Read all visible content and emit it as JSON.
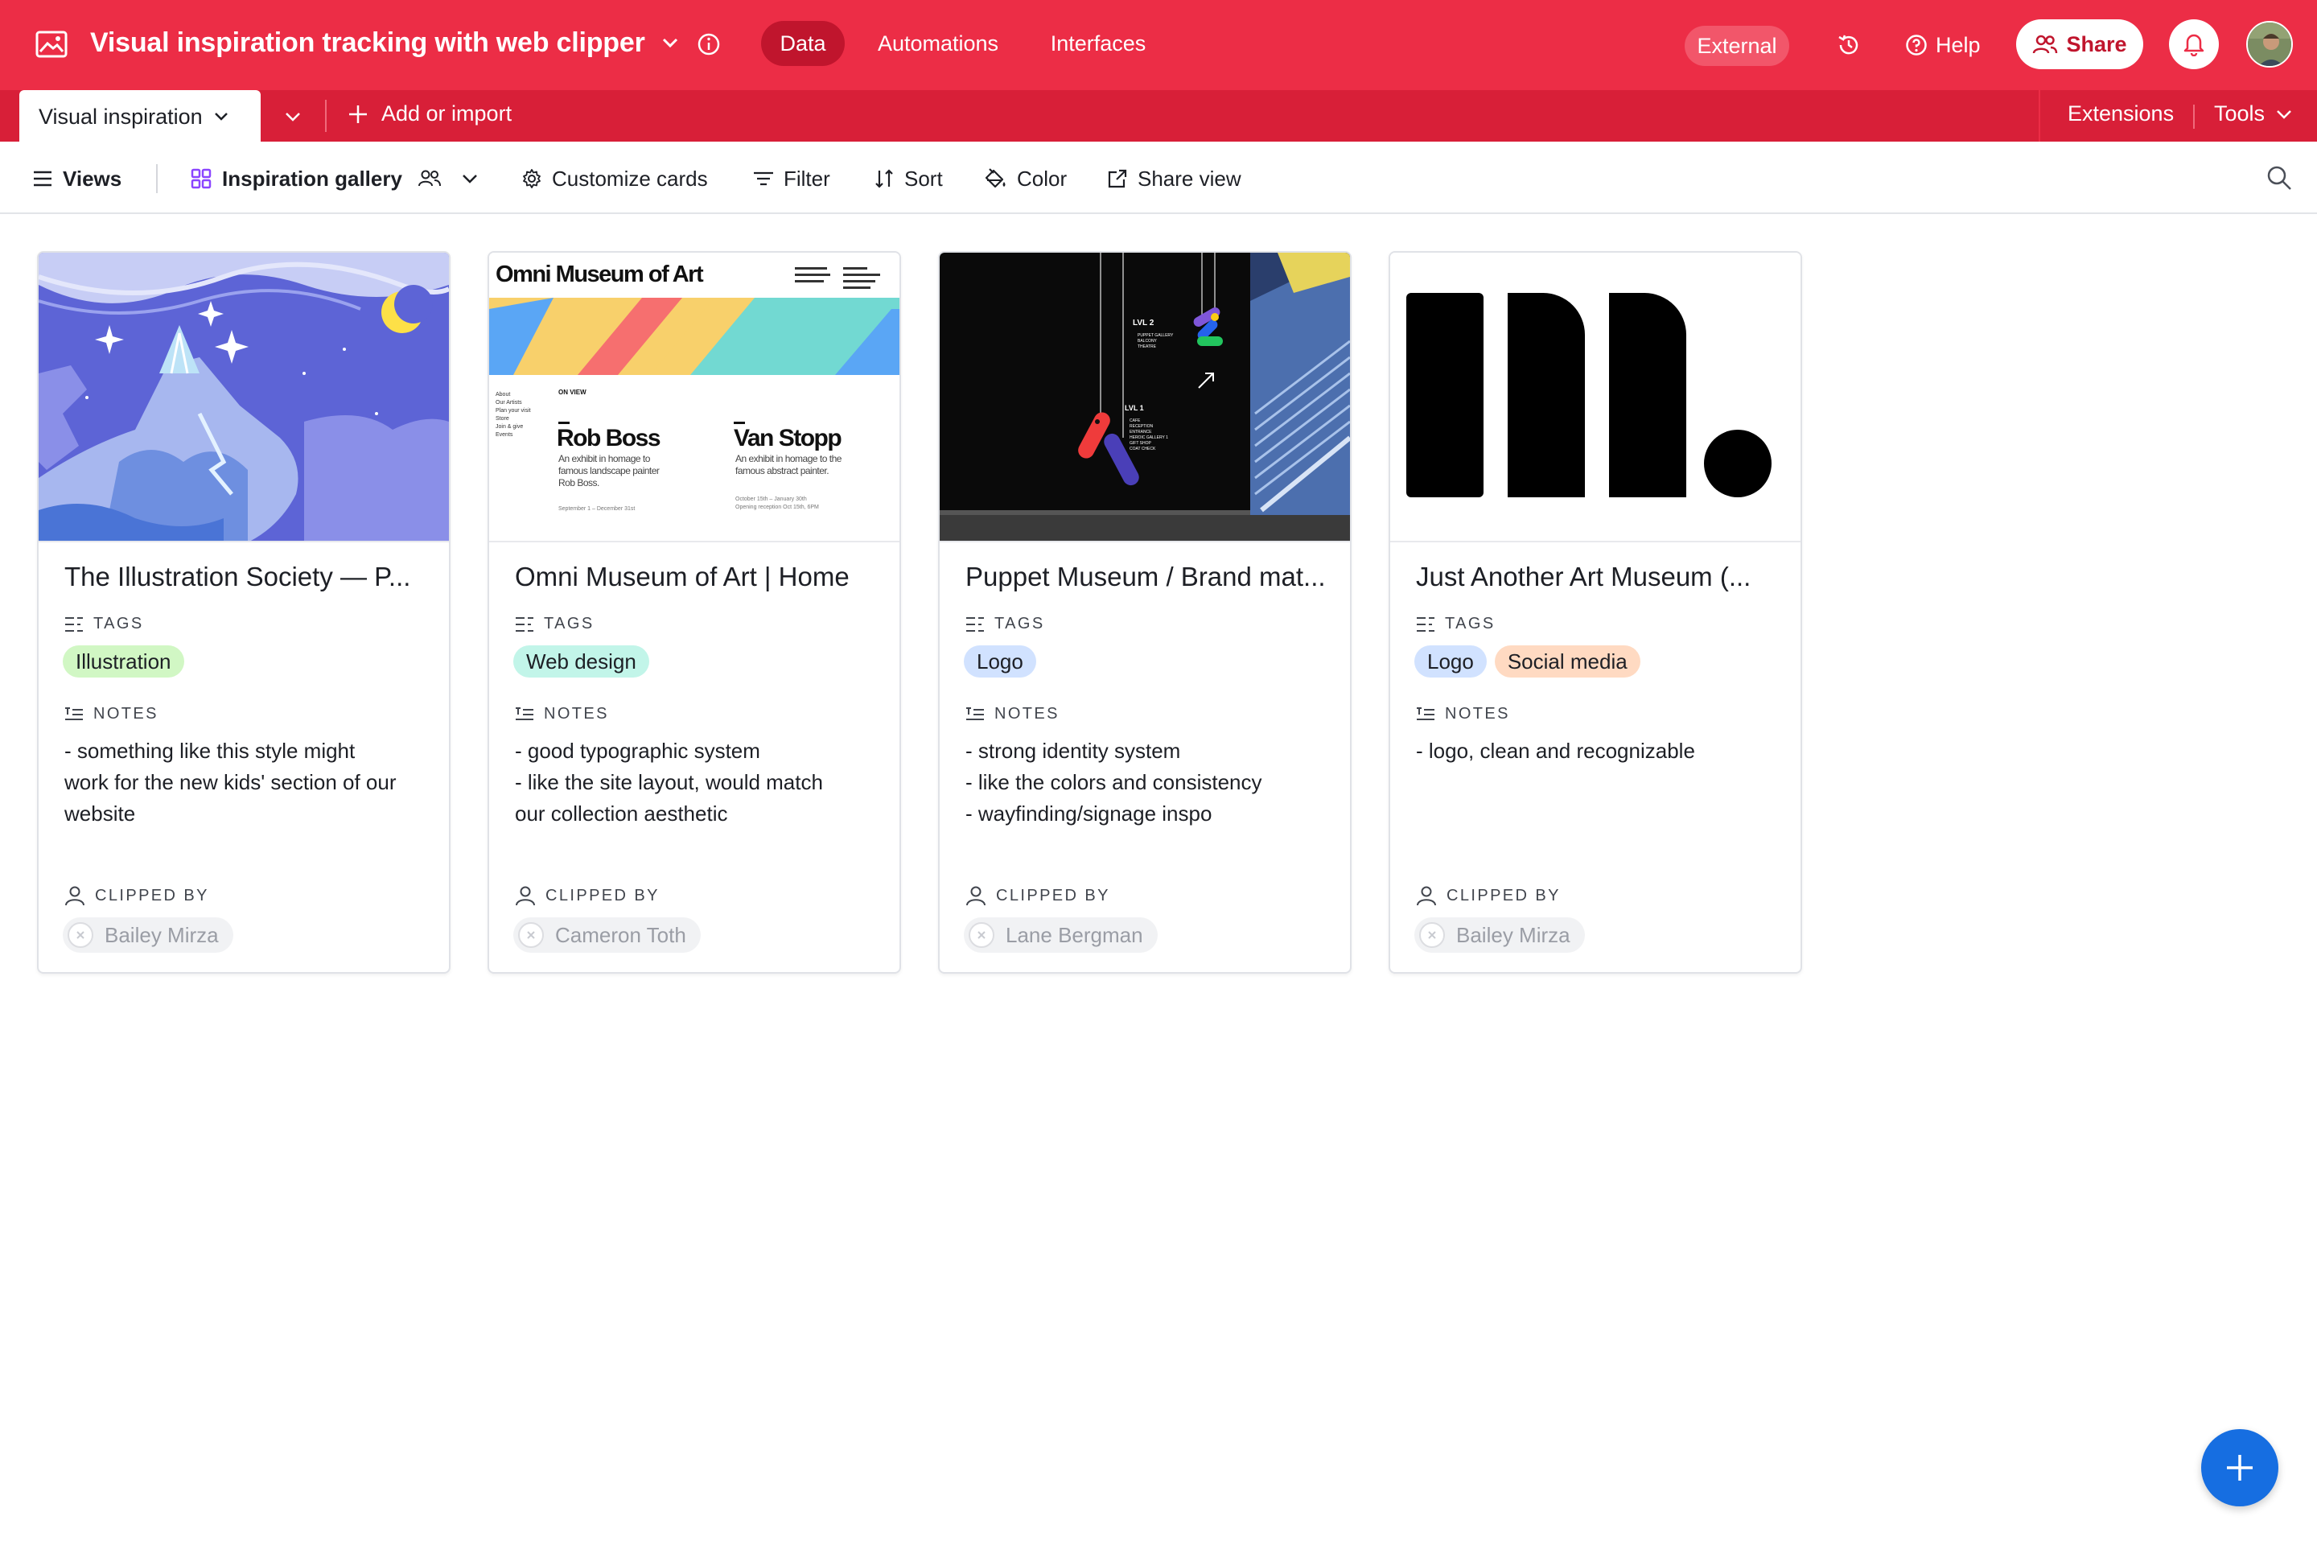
{
  "header": {
    "base_title": "Visual inspiration tracking with web clipper",
    "nav": {
      "data": "Data",
      "automations": "Automations",
      "interfaces": "Interfaces"
    },
    "external_badge": "External",
    "help_label": "Help",
    "share_label": "Share",
    "brand_color": "#ec2d46"
  },
  "tabs": {
    "active_table": "Visual inspiration",
    "add_import": "Add or import",
    "extensions": "Extensions",
    "tools": "Tools"
  },
  "toolbar": {
    "views": "Views",
    "view_name": "Inspiration gallery",
    "customize": "Customize cards",
    "filter": "Filter",
    "sort": "Sort",
    "color": "Color",
    "share_view": "Share view"
  },
  "field_labels": {
    "tags": "TAGS",
    "notes": "NOTES",
    "clipped_by": "CLIPPED BY"
  },
  "cards": [
    {
      "title": "The Illustration Society — P...",
      "tags": [
        {
          "label": "Illustration",
          "color": "#d1f7c4"
        }
      ],
      "notes": [
        "- something like this style might",
        "work for the new kids' section of our",
        "website"
      ],
      "clipped_by": "Bailey Mirza"
    },
    {
      "title": "Omni Museum of Art | Home",
      "tags": [
        {
          "label": "Web design",
          "color": "#c2f5e9"
        }
      ],
      "notes": [
        "- good typographic system",
        "- like the site layout, would match",
        "our collection aesthetic"
      ],
      "clipped_by": "Cameron Toth",
      "thumb": {
        "heading": "Omni Museum of Art",
        "on_view": "ON VIEW",
        "exhibit_1_title": "Rob Boss",
        "exhibit_1_desc_1": "An exhibit in homage to",
        "exhibit_1_desc_2": "famous landscape painter",
        "exhibit_1_desc_3": "Rob Boss.",
        "exhibit_1_dates": "September 1 – December 31st",
        "exhibit_2_title": "Van Stopp",
        "exhibit_2_desc_1": "An exhibit in homage to the",
        "exhibit_2_desc_2": "famous abstract painter.",
        "exhibit_2_dates_1": "October 15th – January 30th",
        "exhibit_2_dates_2": "Opening reception Oct 15th, 6PM",
        "menu": [
          "About",
          "Our Artists",
          "Plan your visit",
          "Store",
          "Join & give",
          "Events"
        ]
      }
    },
    {
      "title": "Puppet Museum / Brand mat...",
      "tags": [
        {
          "label": "Logo",
          "color": "#d1e2ff"
        }
      ],
      "notes": [
        "- strong identity system",
        "- like the colors and consistency",
        "- wayfinding/signage inspo"
      ],
      "clipped_by": "Lane Bergman",
      "thumb": {
        "lvl2": "LVL 2",
        "lvl2_items": [
          "PUPPET GALLERY",
          "BALCONY",
          "THEATRE"
        ],
        "lvl1": "LVL 1",
        "lvl1_items": [
          "CAFE",
          "RECEPTION",
          "ENTRANCE",
          "HEROIC GALLERY 1",
          "GIFT SHOP",
          "COAT CHECK"
        ]
      }
    },
    {
      "title": "Just Another Art Museum (...",
      "tags": [
        {
          "label": "Logo",
          "color": "#d1e2ff"
        },
        {
          "label": "Social media",
          "color": "#ffdac2"
        }
      ],
      "notes": [
        "- logo, clean and recognizable"
      ],
      "clipped_by": "Bailey Mirza"
    }
  ],
  "fab_icon": "plus-icon"
}
